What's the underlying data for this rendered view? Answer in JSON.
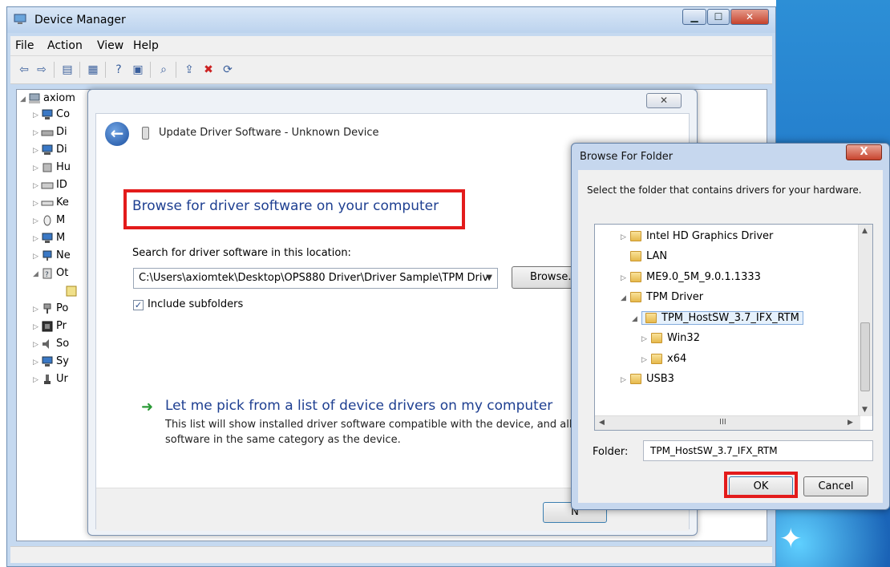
{
  "device_manager": {
    "title": "Device Manager",
    "menu": [
      "File",
      "Action",
      "View",
      "Help"
    ],
    "tree": [
      {
        "label": "axiom",
        "level": 0,
        "expanded": true
      },
      {
        "label": "Co",
        "level": 1
      },
      {
        "label": "Di",
        "level": 1
      },
      {
        "label": "Di",
        "level": 1
      },
      {
        "label": "Hu",
        "level": 1
      },
      {
        "label": "ID",
        "level": 1
      },
      {
        "label": "Ke",
        "level": 1
      },
      {
        "label": "M",
        "level": 1
      },
      {
        "label": "M",
        "level": 1
      },
      {
        "label": "Ne",
        "level": 1
      },
      {
        "label": "Ot",
        "level": 1,
        "expanded": true
      },
      {
        "label": "",
        "level": 2
      },
      {
        "label": "Po",
        "level": 1
      },
      {
        "label": "Pr",
        "level": 1
      },
      {
        "label": "So",
        "level": 1
      },
      {
        "label": "Sy",
        "level": 1
      },
      {
        "label": "Ur",
        "level": 1
      }
    ]
  },
  "update_driver": {
    "title": "Update Driver Software - Unknown Device",
    "heading": "Browse for driver software on your computer",
    "search_label": "Search for driver software in this location:",
    "path_value": "C:\\Users\\axiomtek\\Desktop\\OPS880 Driver\\Driver Sample\\TPM Driv",
    "browse_label": "Browse...",
    "include_subfolders_label": "Include subfolders",
    "include_subfolders_checked": true,
    "pick_title": "Let me pick from a list of device drivers on my computer",
    "pick_desc": "This list will show installed driver software compatible with the device, and all d software in the same category as the device.",
    "next_label": "N"
  },
  "browse_folder": {
    "title": "Browse For Folder",
    "close_label": "X",
    "instruction": "Select the folder that contains drivers for your hardware.",
    "folders": [
      {
        "label": "Intel  HD Graphics Driver",
        "level": 0,
        "expand": "collapsed"
      },
      {
        "label": "LAN",
        "level": 0,
        "expand": "none"
      },
      {
        "label": "ME9.0_5M_9.0.1.1333",
        "level": 0,
        "expand": "collapsed"
      },
      {
        "label": "TPM Driver",
        "level": 0,
        "expand": "expanded"
      },
      {
        "label": "TPM_HostSW_3.7_IFX_RTM",
        "level": 1,
        "expand": "expanded",
        "selected": true
      },
      {
        "label": "Win32",
        "level": 2,
        "expand": "collapsed"
      },
      {
        "label": "x64",
        "level": 2,
        "expand": "collapsed"
      },
      {
        "label": "USB3",
        "level": 0,
        "expand": "collapsed"
      }
    ],
    "hscroll_label": "III",
    "folder_label": "Folder:",
    "folder_value": "TPM_HostSW_3.7_IFX_RTM",
    "ok_label": "OK",
    "cancel_label": "Cancel"
  },
  "colors": {
    "highlight_red": "#e31b1b",
    "heading_blue": "#1e3f91",
    "desktop_blue": "#1c6fc4"
  }
}
